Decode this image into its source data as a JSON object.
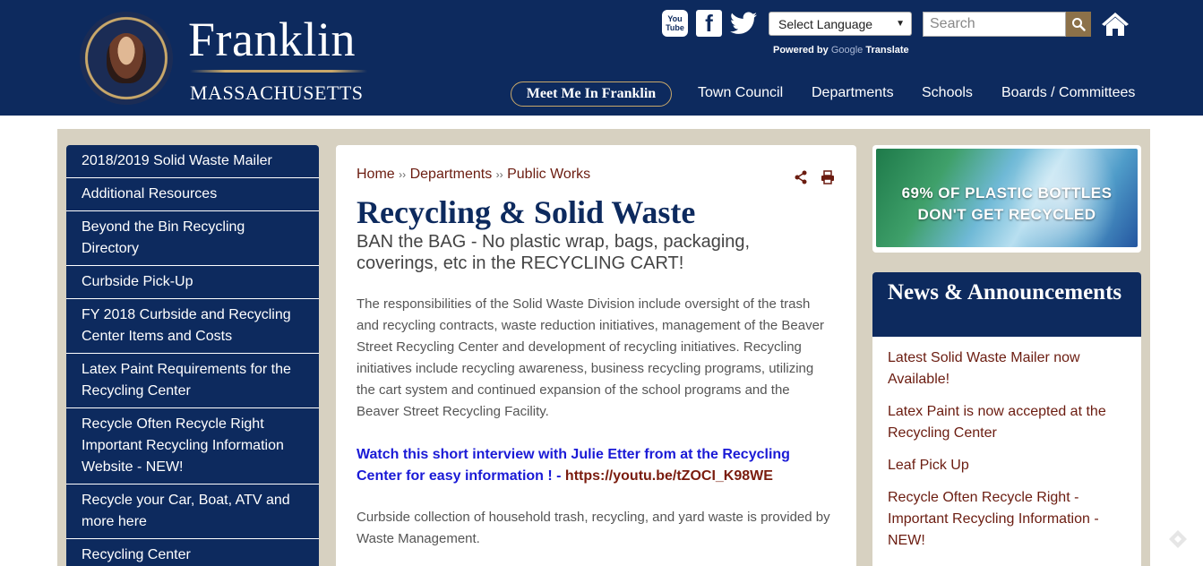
{
  "header": {
    "brand_title": "Franklin",
    "brand_subtitle": "MASSACHUSETTS",
    "seal_icon": "town-seal-icon",
    "social": {
      "youtube_label_top": "You",
      "youtube_label_bottom": "Tube",
      "facebook_glyph": "f"
    },
    "language_select": "Select Language",
    "powered_by": "Powered by",
    "google": "Google",
    "translate": "Translate",
    "search_placeholder": "Search",
    "nav": {
      "pill": "Meet Me In Franklin",
      "items": [
        "Town Council",
        "Departments",
        "Schools",
        "Boards / Committees"
      ]
    }
  },
  "sidebar": {
    "items": [
      "2018/2019 Solid Waste Mailer",
      "Additional Resources",
      "Beyond the Bin Recycling Directory",
      "Curbside Pick-Up",
      "FY 2018 Curbside and Recycling Center Items and Costs",
      "Latex Paint Requirements for the Recycling Center",
      "Recycle Often Recycle Right Important Recycling Information Website - NEW!",
      "Recycle your Car, Boat, ATV and more here",
      "Recycling Center"
    ]
  },
  "main": {
    "breadcrumb": [
      "Home",
      "Departments",
      "Public Works"
    ],
    "breadcrumb_sep": "››",
    "title": "Recycling & Solid Waste",
    "subtitle": "BAN the BAG - No plastic wrap, bags, packaging, coverings, etc in the RECYCLING CART!",
    "paragraph1": "The responsibilities of the Solid Waste Division include oversight of the trash and recycling contracts, waste reduction initiatives, management of the Beaver Street Recycling Center and development of recycling initiatives.  Recycling initiatives include recycling awareness, business recycling programs, utilizing the cart system and continued expansion of the school programs and the Beaver Street Recycling Facility.",
    "video_text": "Watch this short interview with Julie Etter from at the Recycling Center for easy information !  - ",
    "video_link": "https://youtu.be/tZOCI_K98WE",
    "paragraph2": "Curbside collection of household trash, recycling, and yard waste is provided by Waste Management."
  },
  "promo": {
    "text": "69% OF PLASTIC BOTTLES DON'T GET RECYCLED"
  },
  "news": {
    "heading": "News & Announcements",
    "items": [
      "Latest Solid Waste Mailer now Available!",
      "Latex Paint is now accepted at the Recycling Center",
      "Leaf Pick Up",
      "Recycle Often Recycle Right - Important Recycling Information - NEW!"
    ]
  },
  "colors": {
    "navy": "#0d2a5e",
    "gold": "#c9a86a",
    "maroon": "#6b1c10",
    "beige": "#d7d1c1"
  }
}
